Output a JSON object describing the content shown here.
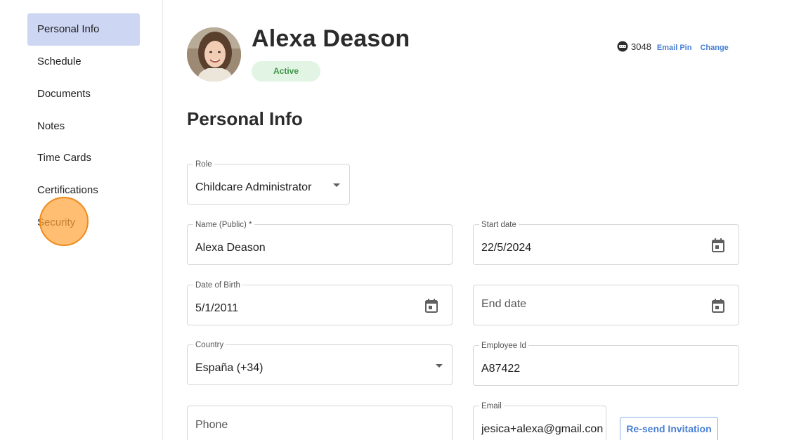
{
  "sidebar": {
    "items": [
      {
        "label": "Personal Info",
        "active": true
      },
      {
        "label": "Schedule"
      },
      {
        "label": "Documents"
      },
      {
        "label": "Notes"
      },
      {
        "label": "Time Cards"
      },
      {
        "label": "Certifications"
      },
      {
        "label": "Security"
      }
    ]
  },
  "profile": {
    "name": "Alexa Deason",
    "status": "Active",
    "pin": "3048",
    "email_pin_label": "Email Pin",
    "change_label": "Change"
  },
  "section_title": "Personal Info",
  "form": {
    "role": {
      "label": "Role",
      "value": "Childcare Administrator"
    },
    "name": {
      "label": "Name (Public) *",
      "value": "Alexa Deason"
    },
    "start_date": {
      "label": "Start date",
      "value": "22/5/2024"
    },
    "date_of_birth": {
      "label": "Date of Birth",
      "value": "5/1/2011"
    },
    "end_date": {
      "placeholder": "End date"
    },
    "country": {
      "label": "Country",
      "value": "España (+34)"
    },
    "employee_id": {
      "label": "Employee Id",
      "value": "A87422"
    },
    "phone": {
      "placeholder": "Phone"
    },
    "email": {
      "label": "Email",
      "value": "jesica+alexa@gmail.con"
    },
    "resend_label": "Re-send Invitation"
  },
  "icons": {
    "pin": "keypad-icon",
    "calendar": "calendar-icon",
    "dropdown": "caret-down-icon"
  },
  "colors": {
    "active_nav": "#cdd6f3",
    "link": "#4a7fd3",
    "status_bg": "#e2f4e4",
    "status_text": "#3f9447",
    "click_marker": "#f0a050"
  }
}
